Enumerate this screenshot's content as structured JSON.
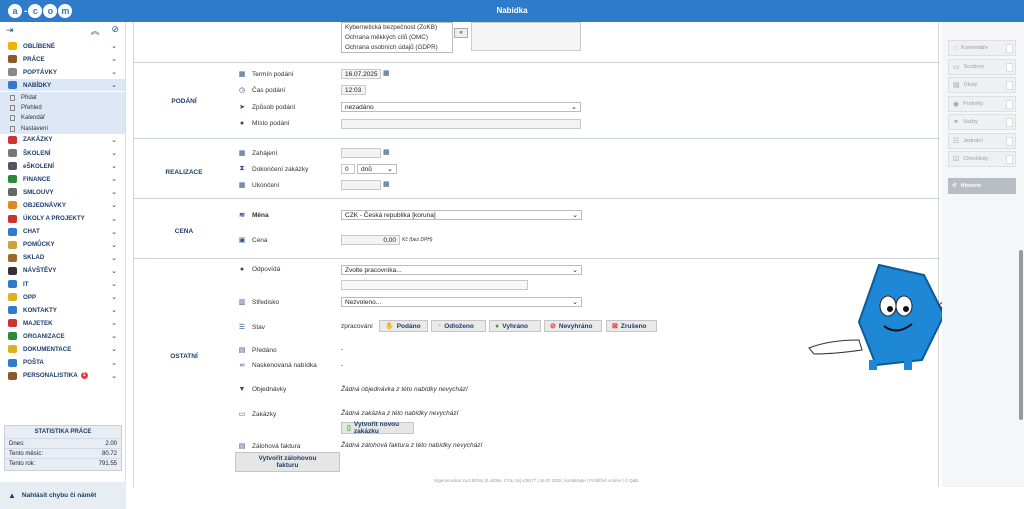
{
  "app": {
    "title": "Nabídka",
    "logo_letters": [
      "a",
      "c",
      "o",
      "m"
    ]
  },
  "colors": {
    "brand": "#2d7bc9",
    "nav_text": "#1b3d6b",
    "accent_red": "#e23b3b"
  },
  "sidebar": {
    "items": [
      {
        "label": "OBLÍBENÉ",
        "icon": "star-icon",
        "color": "#f0b400"
      },
      {
        "label": "PRÁCE",
        "icon": "briefcase-icon",
        "color": "#8b5a2b"
      },
      {
        "label": "POPTÁVKY",
        "icon": "lightbulb-icon",
        "color": "#888"
      },
      {
        "label": "NABÍDKY",
        "icon": "handshake-icon",
        "color": "#2d7bc9",
        "active": true
      },
      {
        "label": "ZAKÁZKY",
        "icon": "truck-icon",
        "color": "#c33"
      },
      {
        "label": "ŠKOLENÍ",
        "icon": "school-icon",
        "color": "#777"
      },
      {
        "label": "eŠKOLENÍ",
        "icon": "elearning-icon",
        "color": "#556"
      },
      {
        "label": "FINANCE",
        "icon": "money-icon",
        "color": "#2a8a3a"
      },
      {
        "label": "SMLOUVY",
        "icon": "contract-icon",
        "color": "#666"
      },
      {
        "label": "OBJEDNÁVKY",
        "icon": "cart-icon",
        "color": "#e08a1e"
      },
      {
        "label": "ÚKOLY A PROJEKTY",
        "icon": "tasks-icon",
        "color": "#c33"
      },
      {
        "label": "CHAT",
        "icon": "chat-icon",
        "color": "#2d7bc9"
      },
      {
        "label": "POMŮCKY",
        "icon": "tools-icon",
        "color": "#c8a23a"
      },
      {
        "label": "SKLAD",
        "icon": "warehouse-icon",
        "color": "#9a6a2a"
      },
      {
        "label": "NÁVŠTĚVY",
        "icon": "visitor-icon",
        "color": "#333"
      },
      {
        "label": "IT",
        "icon": "computer-icon",
        "color": "#2d7bc9"
      },
      {
        "label": "OPP",
        "icon": "ppe-icon",
        "color": "#e0b020"
      },
      {
        "label": "KONTAKTY",
        "icon": "contacts-icon",
        "color": "#2d7bc9"
      },
      {
        "label": "MAJETEK",
        "icon": "assets-icon",
        "color": "#c33"
      },
      {
        "label": "ORGANIZACE",
        "icon": "organization-icon",
        "color": "#2a8a3a"
      },
      {
        "label": "DOKUMENTACE",
        "icon": "folder-icon",
        "color": "#e0b020"
      },
      {
        "label": "POŠTA",
        "icon": "mail-icon",
        "color": "#2d7bc9"
      },
      {
        "label": "PERSONALISTIKA",
        "icon": "people-icon",
        "color": "#8b5a2b",
        "badge": "1"
      }
    ],
    "subitems": [
      "Přidat",
      "Přehled",
      "Kalendář",
      "Nastavení"
    ],
    "stats": {
      "title": "STATISTIKA PRÁCE",
      "rows": [
        {
          "label": "Dnes:",
          "value": "2.00"
        },
        {
          "label": "Tento měsíc:",
          "value": "80.72"
        },
        {
          "label": "Tento rok:",
          "value": "791.55"
        }
      ]
    },
    "report": "Nahlásit chybu či námět"
  },
  "top_list": {
    "items": [
      "Kybernetická bezpečnost (ZoKB)",
      "Ochrana měkkých cílů (OMC)",
      "Ochrana osobních údajů (GDPR)"
    ],
    "move_btn": "«"
  },
  "podani": {
    "section": "PODÁNÍ",
    "termin_label": "Termín podání",
    "termin_value": "16.07.2025",
    "cas_label": "Čas podání",
    "cas_value": "12:03",
    "zpusob_label": "Způsob podání",
    "zpusob_value": "nezadáno",
    "misto_label": "Místo podání",
    "misto_value": ""
  },
  "realizace": {
    "section": "REALIZACE",
    "zahajeni_label": "Zahájení",
    "dokonceni_label": "Dokončení zakázky",
    "dokonceni_num": "0",
    "dokonceni_unit": "dnů",
    "ukonceni_label": "Ukončení"
  },
  "cena": {
    "section": "CENA",
    "mena_label": "Měna",
    "mena_value": "CZK - Česká republika [koruna]",
    "cena_label": "Cena",
    "cena_value": "0,00",
    "cena_note": "Kč (bez DPH)"
  },
  "ostatni": {
    "section": "OSTATNÍ",
    "odpovida_label": "Odpovídá",
    "odpovida_value": "Zvolte pracovníka...",
    "stredisko_label": "Středisko",
    "stredisko_value": "Nezvoleno...",
    "stav_label": "Stav",
    "stav_current": "zpracování",
    "stav_buttons": [
      {
        "label": "Podáno",
        "icon": "thumb-icon",
        "color": "#e0a020"
      },
      {
        "label": "Odloženo",
        "icon": "pause-icon",
        "color": "#e0b020"
      },
      {
        "label": "Vyhráno",
        "icon": "check-circle-icon",
        "color": "#3aa83a"
      },
      {
        "label": "Nevyhráno",
        "icon": "no-entry-icon",
        "color": "#d33"
      },
      {
        "label": "Zrušeno",
        "icon": "x-box-icon",
        "color": "#d33"
      }
    ],
    "predano_label": "Předáno",
    "predano_value": "-",
    "navazujici_label": "Naskenovaná nabídka",
    "navazujici_value": "-",
    "objednavky_label": "Objednávky",
    "objednavky_value": "Žádná objednávka z této nabídky nevychází",
    "zakazky_label": "Zakázky",
    "zakazky_value": "Žádná zakázka z této nabídky nevychází",
    "zakazky_btn": "Vytvořit novou zakázku",
    "zalohova_label": "Zálohová faktura",
    "zalohova_value": "Žádná zálohová faktura z této nabídky nevychází",
    "zalohova_btn_1": "Vytvořit zálohovou",
    "zalohova_btn_2": "fakturu"
  },
  "right_panel": {
    "items": [
      "Komentáře",
      "Soubory",
      "Úkoly",
      "Podněty",
      "Vazby",
      "Jednání",
      "Checklisty"
    ],
    "history": "Historie"
  },
  "footer": "Vygenerováno za 0.5016s [0.4408s, 170x, 0s] v39177 | 16.07.2025 | kontaktujte | Prohlížeč vnořen | © Q&B"
}
